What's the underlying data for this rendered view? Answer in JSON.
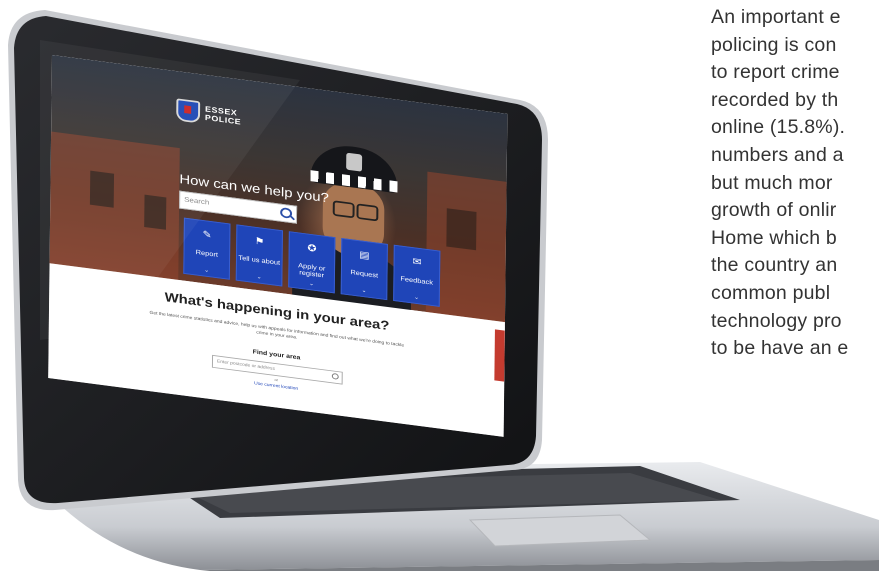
{
  "article": {
    "lines": [
      "An important e",
      "policing is con",
      "to report crime",
      "recorded by th",
      "online (15.8%).",
      "numbers and a",
      "but much mor",
      "growth of onlir",
      "Home which b",
      "the country an",
      "common publ",
      "technology pro",
      "to be have an e"
    ]
  },
  "website": {
    "logo": {
      "line1": "ESSEX",
      "line2": "POLICE"
    },
    "hero": {
      "heading": "How can we help you?",
      "search_placeholder": "Search"
    },
    "tiles": [
      {
        "label": "Report",
        "icon": "report-icon"
      },
      {
        "label": "Tell us about",
        "icon": "flag-icon"
      },
      {
        "label": "Apply or register",
        "icon": "apply-icon"
      },
      {
        "label": "Request",
        "icon": "request-icon"
      },
      {
        "label": "Feedback",
        "icon": "feedback-icon"
      }
    ],
    "area": {
      "heading": "What's happening in your area?",
      "description": "Get the latest crime statistics and advice, help us with appeals for information and find out what we're doing to tackle crime in your area.",
      "find_label": "Find your area",
      "search_placeholder": "Enter postcode or address",
      "or_text": "or",
      "location_link": "Use current location"
    },
    "colors": {
      "tile_blue": "#1f45b8",
      "feedback_red": "#c43b2f"
    }
  }
}
